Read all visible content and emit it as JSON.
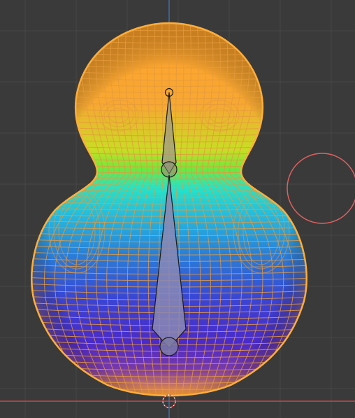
{
  "viewport": {
    "mode": "weight-paint-wireframe",
    "colors": {
      "background": "#3a3a3a",
      "grid_line": "#474747",
      "axis_x": "#c84a4a",
      "axis_z": "#3d6ea8",
      "wire": "#e59a3c",
      "weight_low": "#3d1fd0",
      "weight_high": "#ff9b1e",
      "bone_fill": "#8a88b4",
      "bone_outline": "#1b1b1b",
      "brush_cursor": "#e06060"
    },
    "icons": {
      "brush_cursor": "circle-brush-cursor-icon",
      "origin": "object-origin-icon",
      "bones": "armature-bone-icon"
    },
    "bones": [
      {
        "name": "head-bone"
      },
      {
        "name": "body-bone"
      }
    ]
  }
}
